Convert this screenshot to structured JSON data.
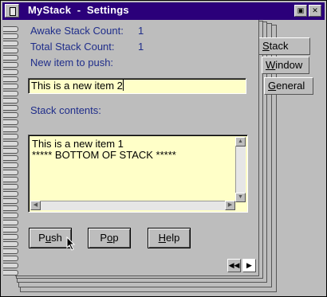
{
  "titlebar": {
    "title": "MyStack  -  Settings",
    "icons": [
      "system-menu-icon",
      "restore-icon",
      "close-icon"
    ]
  },
  "stats": {
    "awake_label": "Awake Stack Count:",
    "awake_value": "1",
    "total_label": "Total Stack Count:",
    "total_value": "1"
  },
  "push_item": {
    "label": "New item to push:",
    "value": "This is a new item 2"
  },
  "stack": {
    "label": "Stack contents:",
    "items": [
      "This is a new item 1",
      "***** BOTTOM OF STACK *****"
    ]
  },
  "buttons": {
    "push": {
      "pre": "P",
      "ul": "u",
      "post": "sh"
    },
    "pop": {
      "pre": "P",
      "ul": "o",
      "post": "p"
    },
    "help": {
      "pre": "",
      "ul": "H",
      "post": "elp"
    }
  },
  "tabs": [
    {
      "pre": "",
      "ul": "S",
      "post": "tack",
      "active": true
    },
    {
      "pre": "",
      "ul": "W",
      "post": "indow",
      "active": false
    },
    {
      "pre": "",
      "ul": "G",
      "post": "eneral",
      "active": false
    }
  ],
  "page_nav": {
    "prev_icon": "page-back-icon",
    "next_icon": "page-forward-icon"
  },
  "colors": {
    "titlebar": "#2b007a",
    "label_text": "#1f2d8a",
    "field_bg": "#ffffc8",
    "window_bg": "#bdbdbd"
  }
}
